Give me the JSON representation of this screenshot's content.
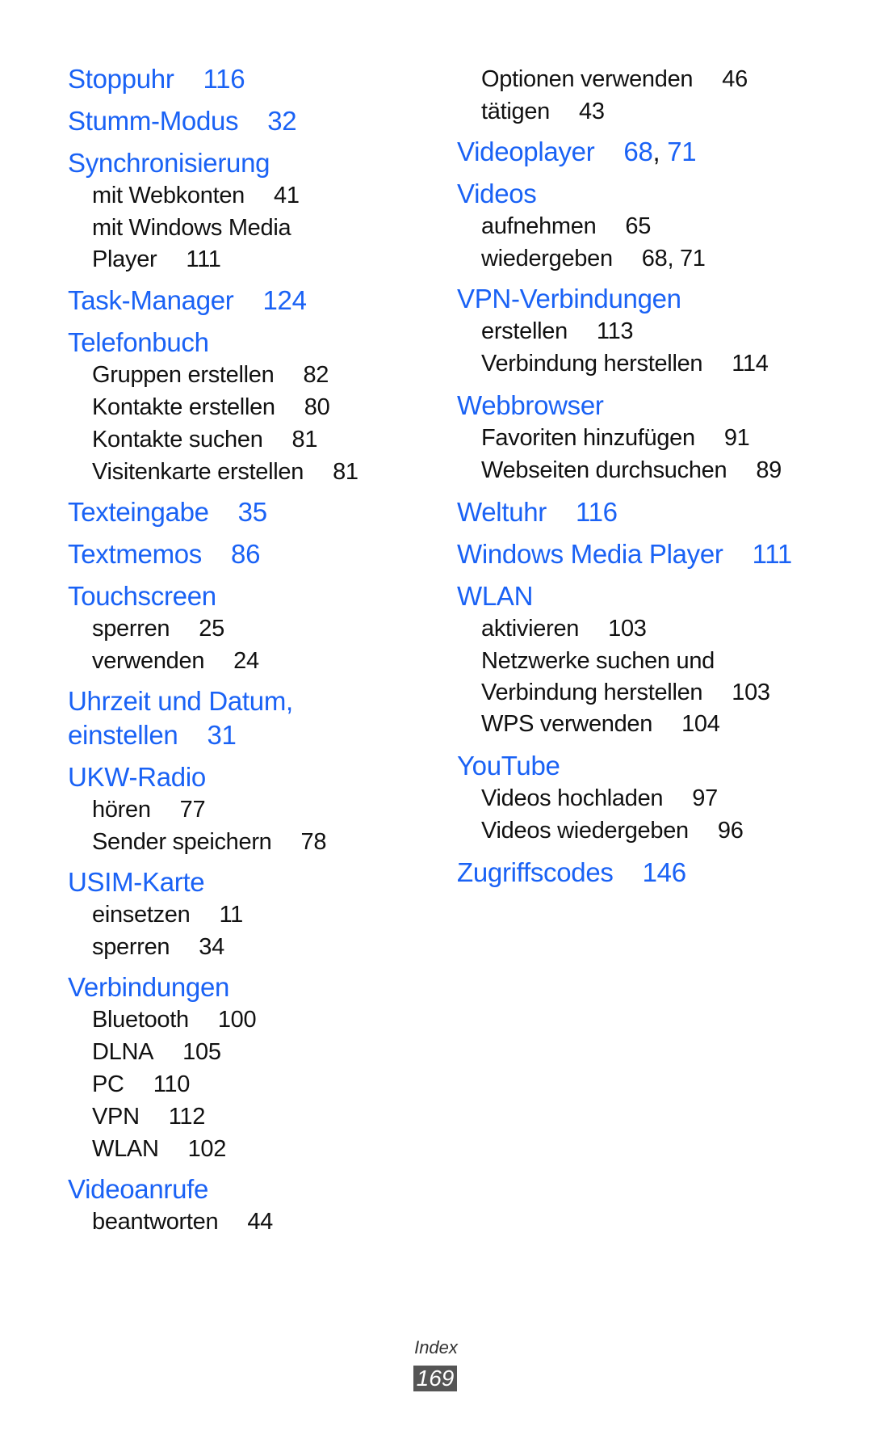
{
  "document": {
    "section": "Index",
    "page_number": "169",
    "colors": {
      "main_entry": "#1a62f5",
      "sub_entry": "#111111",
      "page_badge": "#555555"
    }
  },
  "left_column": [
    {
      "type": "main",
      "text": "Stoppuhr",
      "pages": "116"
    },
    {
      "type": "main",
      "text": "Stumm-Modus",
      "pages": "32"
    },
    {
      "type": "main",
      "text": "Synchronisierung",
      "pages": ""
    },
    {
      "type": "sub",
      "text": "mit Webkonten",
      "pages": "41"
    },
    {
      "type": "sub",
      "text": "mit Windows Media",
      "pages": ""
    },
    {
      "type": "sub",
      "text": "Player",
      "pages": "111"
    },
    {
      "type": "main",
      "text": "Task-Manager",
      "pages": "124"
    },
    {
      "type": "main",
      "text": "Telefonbuch",
      "pages": ""
    },
    {
      "type": "sub",
      "text": "Gruppen erstellen",
      "pages": "82"
    },
    {
      "type": "sub",
      "text": "Kontakte erstellen",
      "pages": "80"
    },
    {
      "type": "sub",
      "text": "Kontakte suchen",
      "pages": "81"
    },
    {
      "type": "sub",
      "text": "Visitenkarte erstellen",
      "pages": "81"
    },
    {
      "type": "main",
      "text": "Texteingabe",
      "pages": "35"
    },
    {
      "type": "main",
      "text": "Textmemos",
      "pages": "86"
    },
    {
      "type": "main",
      "text": "Touchscreen",
      "pages": ""
    },
    {
      "type": "sub",
      "text": "sperren",
      "pages": "25"
    },
    {
      "type": "sub",
      "text": "verwenden",
      "pages": "24"
    },
    {
      "type": "main",
      "text": "Uhrzeit und Datum,",
      "pages": ""
    },
    {
      "type": "main",
      "text": "einstellen",
      "pages": "31"
    },
    {
      "type": "main",
      "text": "UKW-Radio",
      "pages": ""
    },
    {
      "type": "sub",
      "text": "hören",
      "pages": "77"
    },
    {
      "type": "sub",
      "text": "Sender speichern",
      "pages": "78"
    },
    {
      "type": "main",
      "text": "USIM-Karte",
      "pages": ""
    },
    {
      "type": "sub",
      "text": "einsetzen",
      "pages": "11"
    },
    {
      "type": "sub",
      "text": "sperren",
      "pages": "34"
    },
    {
      "type": "main",
      "text": "Verbindungen",
      "pages": ""
    },
    {
      "type": "sub",
      "text": "Bluetooth",
      "pages": "100"
    },
    {
      "type": "sub",
      "text": "DLNA",
      "pages": "105"
    },
    {
      "type": "sub",
      "text": "PC",
      "pages": "110"
    },
    {
      "type": "sub",
      "text": "VPN",
      "pages": "112"
    },
    {
      "type": "sub",
      "text": "WLAN",
      "pages": "102"
    },
    {
      "type": "main",
      "text": "Videoanrufe",
      "pages": ""
    },
    {
      "type": "sub",
      "text": "beantworten",
      "pages": "44"
    }
  ],
  "right_column": [
    {
      "type": "sub",
      "text": "Optionen verwenden",
      "pages": "46"
    },
    {
      "type": "sub",
      "text": "tätigen",
      "pages": "43"
    },
    {
      "type": "main",
      "text": "Videoplayer",
      "pages": "68",
      "pages2": "71"
    },
    {
      "type": "main",
      "text": "Videos",
      "pages": ""
    },
    {
      "type": "sub",
      "text": "aufnehmen",
      "pages": "65"
    },
    {
      "type": "sub",
      "text": "wiedergeben",
      "pages": "68, 71"
    },
    {
      "type": "main",
      "text": "VPN-Verbindungen",
      "pages": ""
    },
    {
      "type": "sub",
      "text": "erstellen",
      "pages": "113"
    },
    {
      "type": "sub",
      "text": "Verbindung herstellen",
      "pages": "114"
    },
    {
      "type": "main",
      "text": "Webbrowser",
      "pages": ""
    },
    {
      "type": "sub",
      "text": "Favoriten hinzufügen",
      "pages": "91"
    },
    {
      "type": "sub",
      "text": "Webseiten durchsuchen",
      "pages": "89"
    },
    {
      "type": "main",
      "text": "Weltuhr",
      "pages": "116"
    },
    {
      "type": "main",
      "text": "Windows Media Player",
      "pages": "111"
    },
    {
      "type": "main",
      "text": "WLAN",
      "pages": ""
    },
    {
      "type": "sub",
      "text": "aktivieren",
      "pages": "103"
    },
    {
      "type": "sub",
      "text": "Netzwerke suchen und",
      "pages": ""
    },
    {
      "type": "sub",
      "text": "Verbindung herstellen",
      "pages": "103"
    },
    {
      "type": "sub",
      "text": "WPS verwenden",
      "pages": "104"
    },
    {
      "type": "main",
      "text": "YouTube",
      "pages": ""
    },
    {
      "type": "sub",
      "text": "Videos hochladen",
      "pages": "97"
    },
    {
      "type": "sub",
      "text": "Videos wiedergeben",
      "pages": "96"
    },
    {
      "type": "main",
      "text": "Zugriffscodes",
      "pages": "146"
    }
  ]
}
